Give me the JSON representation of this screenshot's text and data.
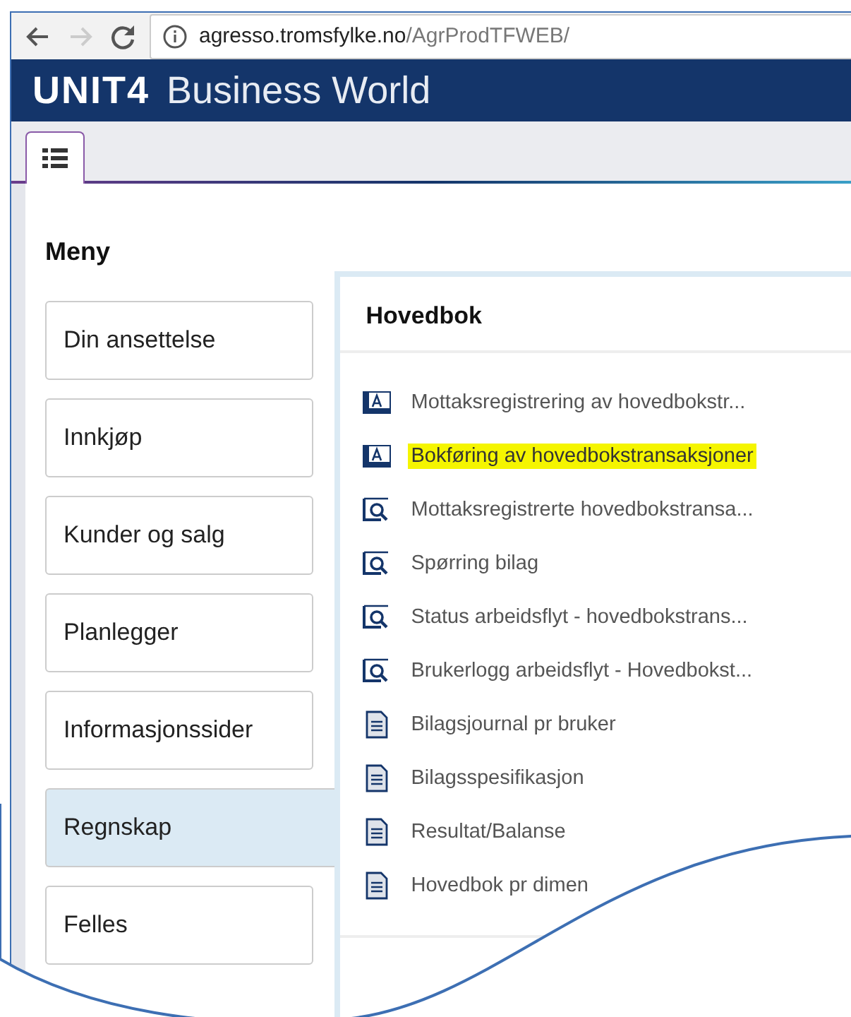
{
  "browser": {
    "back_disabled": false,
    "forward_disabled": true,
    "url_host": "agresso.tromsfylke.no",
    "url_path": "/AgrProdTFWEB/"
  },
  "header": {
    "logo": "UNIT4",
    "title": "Business World"
  },
  "tabs": [
    {
      "selected": true
    }
  ],
  "menu": {
    "title": "Meny",
    "items": [
      {
        "label": "Din ansettelse",
        "selected": false
      },
      {
        "label": "Innkjøp",
        "selected": false
      },
      {
        "label": "Kunder og salg",
        "selected": false
      },
      {
        "label": "Planlegger",
        "selected": false
      },
      {
        "label": "Informasjonssider",
        "selected": false
      },
      {
        "label": "Regnskap",
        "selected": true
      },
      {
        "label": "Felles",
        "selected": false
      }
    ]
  },
  "panel": {
    "title": "Hovedbok",
    "items": [
      {
        "kind": "form",
        "label": "Mottaksregistrering av hovedbokstr...",
        "highlighted": false
      },
      {
        "kind": "form",
        "label": "Bokføring av hovedbokstransaksjoner",
        "highlighted": true
      },
      {
        "kind": "query",
        "label": "Mottaksregistrerte hovedbokstransa...",
        "highlighted": false
      },
      {
        "kind": "query",
        "label": "Spørring bilag",
        "highlighted": false
      },
      {
        "kind": "query",
        "label": "Status arbeidsflyt - hovedbokstrans...",
        "highlighted": false
      },
      {
        "kind": "query",
        "label": "Brukerlogg arbeidsflyt - Hovedbokst...",
        "highlighted": false
      },
      {
        "kind": "report",
        "label": "Bilagsjournal pr bruker",
        "highlighted": false
      },
      {
        "kind": "report",
        "label": "Bilagsspesifikasjon",
        "highlighted": false
      },
      {
        "kind": "report",
        "label": "Resultat/Balanse",
        "highlighted": false
      },
      {
        "kind": "report",
        "label": "Hovedbok pr dimen",
        "highlighted": false
      }
    ]
  }
}
